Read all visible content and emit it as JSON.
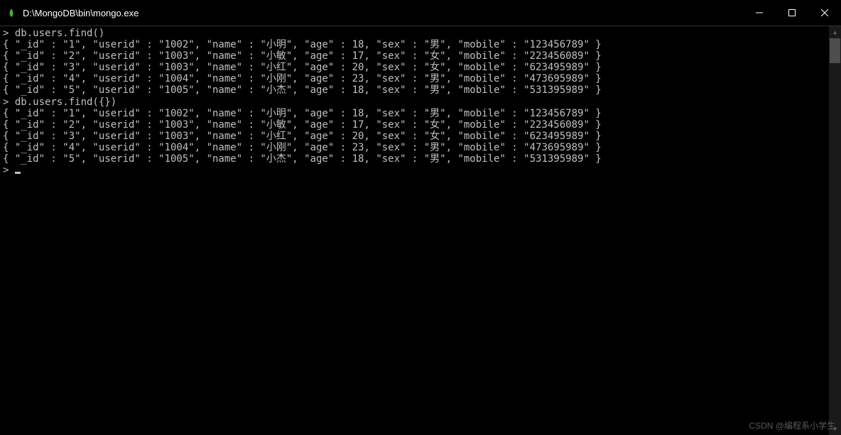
{
  "window": {
    "title": "D:\\MongoDB\\bin\\mongo.exe"
  },
  "console": {
    "command1": "db.users.find()",
    "command2": "db.users.find({})",
    "prompt": ">",
    "records": [
      {
        "_id": "1",
        "userid": "1002",
        "name": "小明",
        "age": 18,
        "sex": "男",
        "mobile": "123456789"
      },
      {
        "_id": "2",
        "userid": "1003",
        "name": "小敏",
        "age": 17,
        "sex": "女",
        "mobile": "223456089"
      },
      {
        "_id": "3",
        "userid": "1003",
        "name": "小红",
        "age": 20,
        "sex": "女",
        "mobile": "623495989"
      },
      {
        "_id": "4",
        "userid": "1004",
        "name": "小刚",
        "age": 23,
        "sex": "男",
        "mobile": "473695989"
      },
      {
        "_id": "5",
        "userid": "1005",
        "name": "小杰",
        "age": 18,
        "sex": "男",
        "mobile": "531395989"
      }
    ]
  },
  "watermark": "CSDN @编程系小学生"
}
